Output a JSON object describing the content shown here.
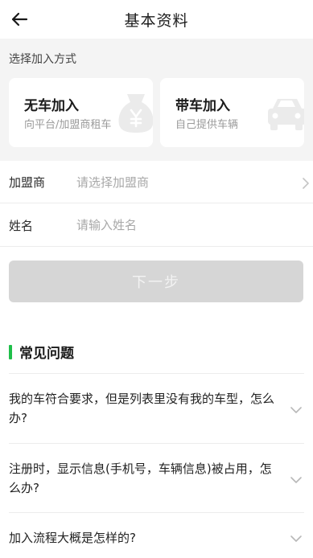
{
  "header": {
    "title": "基本资料",
    "back_icon": "arrow-left-icon"
  },
  "join": {
    "section_label": "选择加入方式",
    "options": [
      {
        "title": "无车加入",
        "subtitle": "向平台/加盟商租车",
        "icon": "money-bag-icon"
      },
      {
        "title": "带车加入",
        "subtitle": "自己提供车辆",
        "icon": "car-icon"
      }
    ]
  },
  "form": {
    "franchisee": {
      "label": "加盟商",
      "placeholder": "请选择加盟商"
    },
    "name": {
      "label": "姓名",
      "placeholder": "请输入姓名"
    }
  },
  "next_button": {
    "label": "下一步"
  },
  "faq": {
    "title": "常见问题",
    "accent_color": "#1fbf4a",
    "items": [
      {
        "question": "我的车符合要求，但是列表里没有我的车型，怎么办?"
      },
      {
        "question": "注册时，显示信息(手机号，车辆信息)被占用，怎么办?"
      },
      {
        "question": "加入流程大概是怎样的?"
      }
    ]
  }
}
